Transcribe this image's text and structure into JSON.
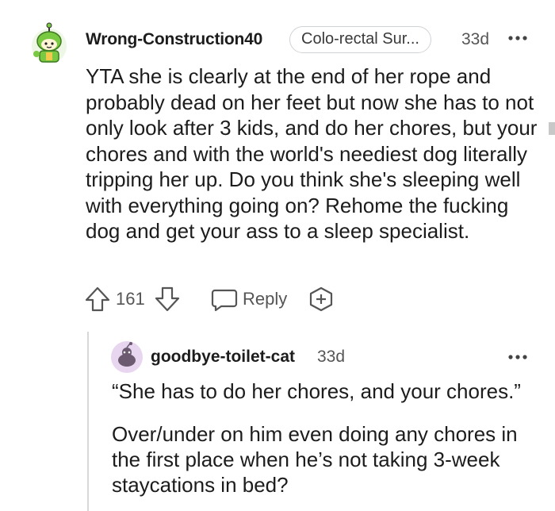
{
  "comment": {
    "username": "Wrong-Construction40",
    "flair": "Colo-rectal Sur...",
    "age": "33d",
    "body": "YTA she is clearly at the end of her rope and probably dead on her feet but now she has to not only look after 3 kids, and do her chores, but your chores and with the world's neediest dog literally tripping her up. Do you think she's sleeping well with everything going on? Rehome the fucking dog and get your ass to a sleep specialist.",
    "votes": "161",
    "reply_label": "Reply"
  },
  "reply": {
    "username": "goodbye-toilet-cat",
    "age": "33d",
    "paragraph1": "“She has to do her chores, and your chores.”",
    "paragraph2": "Over/under on him even doing any chores in the first place when he’s not taking 3-week staycations in bed?"
  },
  "colors": {
    "text": "#1c1c1c",
    "muted": "#555555",
    "avatar1_green": "#7ac943",
    "avatar2_purple": "#e8d5f0"
  },
  "icons": {
    "avatar1": "user-avatar-green-icon",
    "avatar2": "user-avatar-snoo-icon",
    "more": "more-options-icon",
    "upvote": "upvote-arrow-icon",
    "downvote": "downvote-arrow-icon",
    "reply": "reply-bubble-icon",
    "award": "award-plus-icon"
  }
}
